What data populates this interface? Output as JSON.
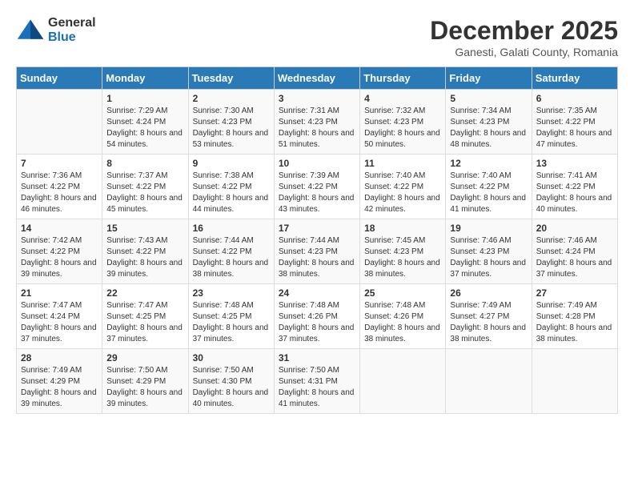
{
  "logo": {
    "general": "General",
    "blue": "Blue"
  },
  "title": "December 2025",
  "subtitle": "Ganesti, Galati County, Romania",
  "days_header": [
    "Sunday",
    "Monday",
    "Tuesday",
    "Wednesday",
    "Thursday",
    "Friday",
    "Saturday"
  ],
  "weeks": [
    [
      {
        "day": "",
        "info": ""
      },
      {
        "day": "1",
        "info": "Sunrise: 7:29 AM\nSunset: 4:24 PM\nDaylight: 8 hours\nand 54 minutes."
      },
      {
        "day": "2",
        "info": "Sunrise: 7:30 AM\nSunset: 4:23 PM\nDaylight: 8 hours\nand 53 minutes."
      },
      {
        "day": "3",
        "info": "Sunrise: 7:31 AM\nSunset: 4:23 PM\nDaylight: 8 hours\nand 51 minutes."
      },
      {
        "day": "4",
        "info": "Sunrise: 7:32 AM\nSunset: 4:23 PM\nDaylight: 8 hours\nand 50 minutes."
      },
      {
        "day": "5",
        "info": "Sunrise: 7:34 AM\nSunset: 4:23 PM\nDaylight: 8 hours\nand 48 minutes."
      },
      {
        "day": "6",
        "info": "Sunrise: 7:35 AM\nSunset: 4:22 PM\nDaylight: 8 hours\nand 47 minutes."
      }
    ],
    [
      {
        "day": "7",
        "info": "Sunrise: 7:36 AM\nSunset: 4:22 PM\nDaylight: 8 hours\nand 46 minutes."
      },
      {
        "day": "8",
        "info": "Sunrise: 7:37 AM\nSunset: 4:22 PM\nDaylight: 8 hours\nand 45 minutes."
      },
      {
        "day": "9",
        "info": "Sunrise: 7:38 AM\nSunset: 4:22 PM\nDaylight: 8 hours\nand 44 minutes."
      },
      {
        "day": "10",
        "info": "Sunrise: 7:39 AM\nSunset: 4:22 PM\nDaylight: 8 hours\nand 43 minutes."
      },
      {
        "day": "11",
        "info": "Sunrise: 7:40 AM\nSunset: 4:22 PM\nDaylight: 8 hours\nand 42 minutes."
      },
      {
        "day": "12",
        "info": "Sunrise: 7:40 AM\nSunset: 4:22 PM\nDaylight: 8 hours\nand 41 minutes."
      },
      {
        "day": "13",
        "info": "Sunrise: 7:41 AM\nSunset: 4:22 PM\nDaylight: 8 hours\nand 40 minutes."
      }
    ],
    [
      {
        "day": "14",
        "info": "Sunrise: 7:42 AM\nSunset: 4:22 PM\nDaylight: 8 hours\nand 39 minutes."
      },
      {
        "day": "15",
        "info": "Sunrise: 7:43 AM\nSunset: 4:22 PM\nDaylight: 8 hours\nand 39 minutes."
      },
      {
        "day": "16",
        "info": "Sunrise: 7:44 AM\nSunset: 4:22 PM\nDaylight: 8 hours\nand 38 minutes."
      },
      {
        "day": "17",
        "info": "Sunrise: 7:44 AM\nSunset: 4:23 PM\nDaylight: 8 hours\nand 38 minutes."
      },
      {
        "day": "18",
        "info": "Sunrise: 7:45 AM\nSunset: 4:23 PM\nDaylight: 8 hours\nand 38 minutes."
      },
      {
        "day": "19",
        "info": "Sunrise: 7:46 AM\nSunset: 4:23 PM\nDaylight: 8 hours\nand 37 minutes."
      },
      {
        "day": "20",
        "info": "Sunrise: 7:46 AM\nSunset: 4:24 PM\nDaylight: 8 hours\nand 37 minutes."
      }
    ],
    [
      {
        "day": "21",
        "info": "Sunrise: 7:47 AM\nSunset: 4:24 PM\nDaylight: 8 hours\nand 37 minutes."
      },
      {
        "day": "22",
        "info": "Sunrise: 7:47 AM\nSunset: 4:25 PM\nDaylight: 8 hours\nand 37 minutes."
      },
      {
        "day": "23",
        "info": "Sunrise: 7:48 AM\nSunset: 4:25 PM\nDaylight: 8 hours\nand 37 minutes."
      },
      {
        "day": "24",
        "info": "Sunrise: 7:48 AM\nSunset: 4:26 PM\nDaylight: 8 hours\nand 37 minutes."
      },
      {
        "day": "25",
        "info": "Sunrise: 7:48 AM\nSunset: 4:26 PM\nDaylight: 8 hours\nand 38 minutes."
      },
      {
        "day": "26",
        "info": "Sunrise: 7:49 AM\nSunset: 4:27 PM\nDaylight: 8 hours\nand 38 minutes."
      },
      {
        "day": "27",
        "info": "Sunrise: 7:49 AM\nSunset: 4:28 PM\nDaylight: 8 hours\nand 38 minutes."
      }
    ],
    [
      {
        "day": "28",
        "info": "Sunrise: 7:49 AM\nSunset: 4:29 PM\nDaylight: 8 hours\nand 39 minutes."
      },
      {
        "day": "29",
        "info": "Sunrise: 7:50 AM\nSunset: 4:29 PM\nDaylight: 8 hours\nand 39 minutes."
      },
      {
        "day": "30",
        "info": "Sunrise: 7:50 AM\nSunset: 4:30 PM\nDaylight: 8 hours\nand 40 minutes."
      },
      {
        "day": "31",
        "info": "Sunrise: 7:50 AM\nSunset: 4:31 PM\nDaylight: 8 hours\nand 41 minutes."
      },
      {
        "day": "",
        "info": ""
      },
      {
        "day": "",
        "info": ""
      },
      {
        "day": "",
        "info": ""
      }
    ]
  ]
}
